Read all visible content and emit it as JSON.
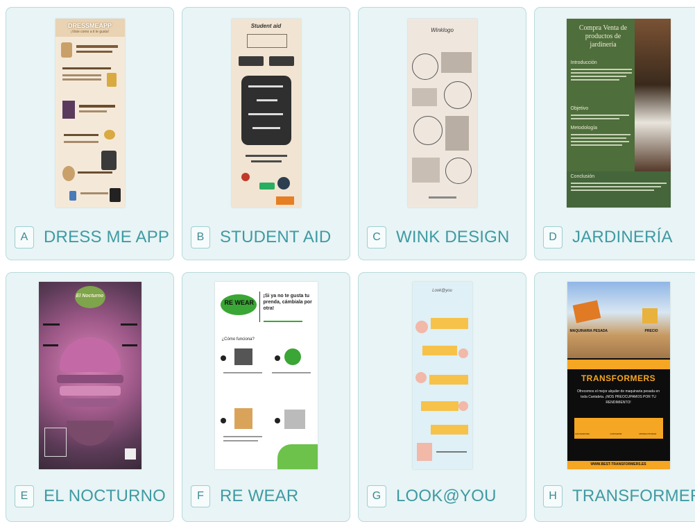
{
  "cards": [
    {
      "letter": "A",
      "label": "DRESS ME APP",
      "thumb": {
        "title": "DRESSMEAPP",
        "subtitle": "¡Viste como a ti te gusta!"
      }
    },
    {
      "letter": "B",
      "label": "STUDENT AID",
      "thumb": {
        "title": "Student aid"
      }
    },
    {
      "letter": "C",
      "label": "WINK DESIGN",
      "thumb": {
        "title": "Winklogo"
      }
    },
    {
      "letter": "D",
      "label": "JARDINERÍA",
      "thumb": {
        "title": "Compra Venta de productos de jardinería",
        "sections": [
          "Introducción",
          "Objetivo",
          "Metodología",
          "Conclusión"
        ]
      }
    },
    {
      "letter": "E",
      "label": "EL NOCTURNO",
      "thumb": {
        "title": "El Nocturno"
      }
    },
    {
      "letter": "F",
      "label": "RE WEAR",
      "thumb": {
        "logo": "RE WEAR",
        "headline": "¡Si ya no te gusta tu prenda, cámbiala por otra!",
        "how": "¿Cómo funciona?"
      }
    },
    {
      "letter": "G",
      "label": "LOOK@YOU",
      "thumb": {
        "title": "Look@you"
      }
    },
    {
      "letter": "H",
      "label": "TRANSFORMERS",
      "thumb": {
        "col1": "MAQUINARIA PESADA",
        "col2": "PRECIO",
        "title": "TRANSFORMERS",
        "body": "Ofrecemos el mejor alquiler de maquinaria pesada en toda Cantabria. ¡NOS PREOCUPAMOS POR TU RENDIMIENTO!",
        "icons": [
          "EXCAVADORA",
          "CONTADOR",
          "PRODUCTIVIDAD"
        ],
        "footer": "WWW.BEST-TRANSFORMERS.ES"
      }
    }
  ],
  "colors": {
    "card_bg": "#e8f4f5",
    "card_border": "#b9dbde",
    "label": "#3f9aa3"
  }
}
